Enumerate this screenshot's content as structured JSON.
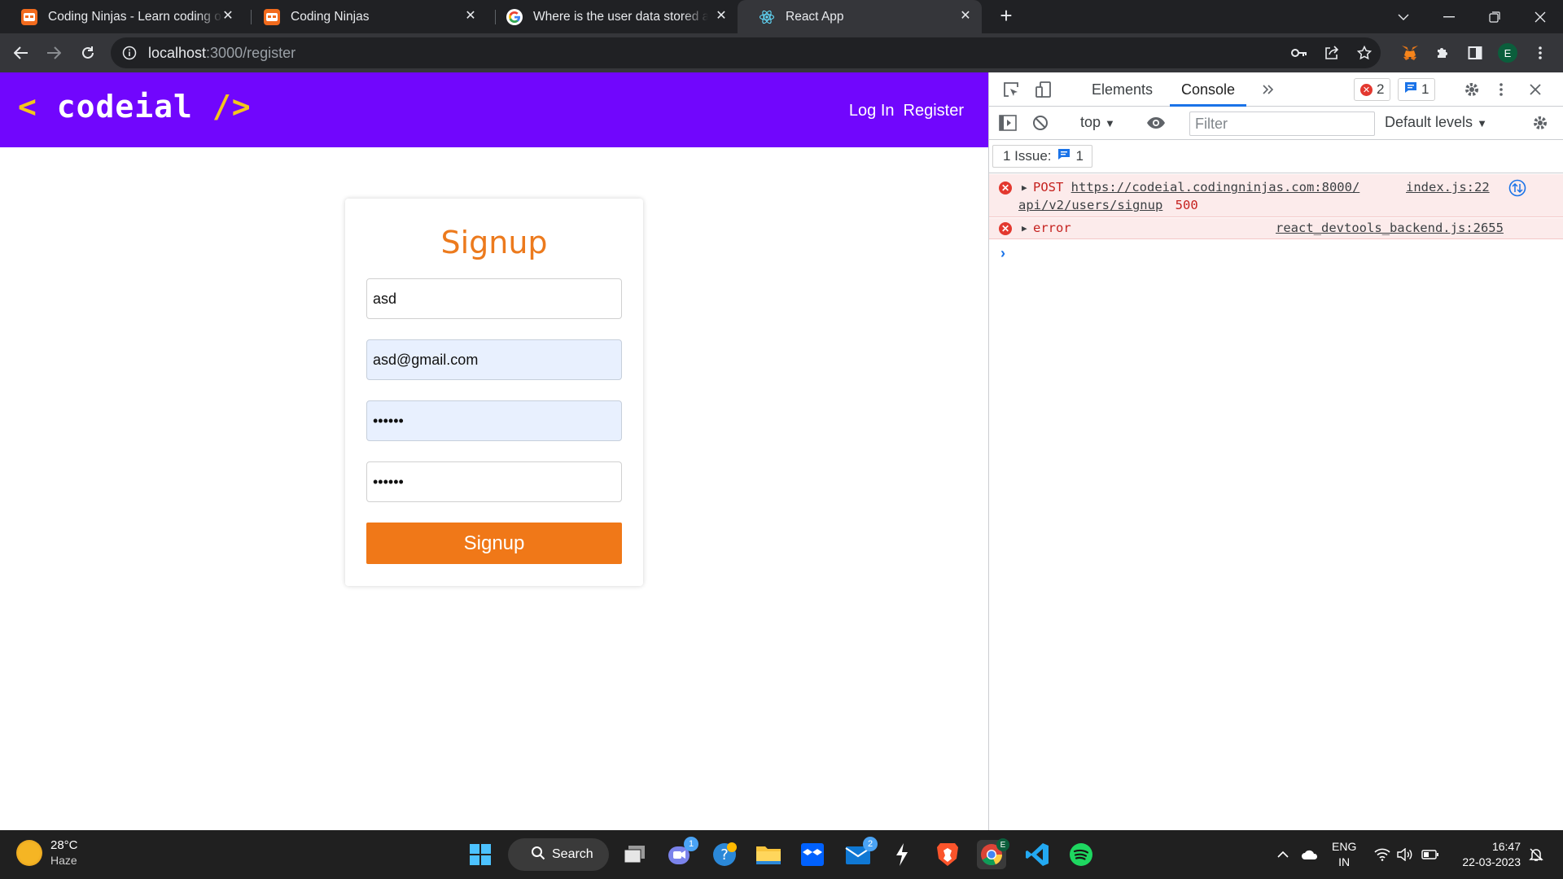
{
  "browser": {
    "tabs": [
      {
        "title": "Coding Ninjas - Learn coding online",
        "favicon": "coding-ninjas-icon",
        "active": false
      },
      {
        "title": "Coding Ninjas",
        "favicon": "coding-ninjas-icon",
        "active": false
      },
      {
        "title": "Where is the user data stored after signup",
        "favicon": "google-icon",
        "active": false
      },
      {
        "title": "React App",
        "favicon": "react-icon",
        "active": true
      }
    ],
    "url_host": "localhost",
    "url_path": ":3000/register",
    "profile_initial": "E"
  },
  "app": {
    "logo_open": "<",
    "logo_text": "codeial",
    "logo_close": "/>",
    "nav": {
      "login": "Log In",
      "register": "Register"
    },
    "brand_color": "#7106fd",
    "accent_color": "#f07818"
  },
  "signup": {
    "heading": "Signup",
    "name_value": "asd",
    "email_value": "asd@gmail.com",
    "password_value": "••••••",
    "confirm_value": "••••••",
    "button_label": "Signup"
  },
  "devtools": {
    "tabs": {
      "elements": "Elements",
      "console": "Console"
    },
    "error_count": "2",
    "message_count": "1",
    "context": "top",
    "filter_placeholder": "Filter",
    "levels": "Default levels",
    "issues_label": "1 Issue:",
    "issues_count": "1",
    "messages": [
      {
        "method": "POST",
        "url_line1": "https://codeial.codingninjas.com:8000/",
        "url_line2": "api/v2/users/signup",
        "status": "500",
        "source": "index.js:22"
      },
      {
        "text": "error",
        "source": "react_devtools_backend.js:2655"
      }
    ]
  },
  "taskbar": {
    "temperature": "28°C",
    "weather": "Haze",
    "search_label": "Search",
    "teams_badge": "1",
    "mail_badge": "2",
    "lang1": "ENG",
    "lang2": "IN",
    "time": "16:47",
    "date": "22-03-2023"
  }
}
